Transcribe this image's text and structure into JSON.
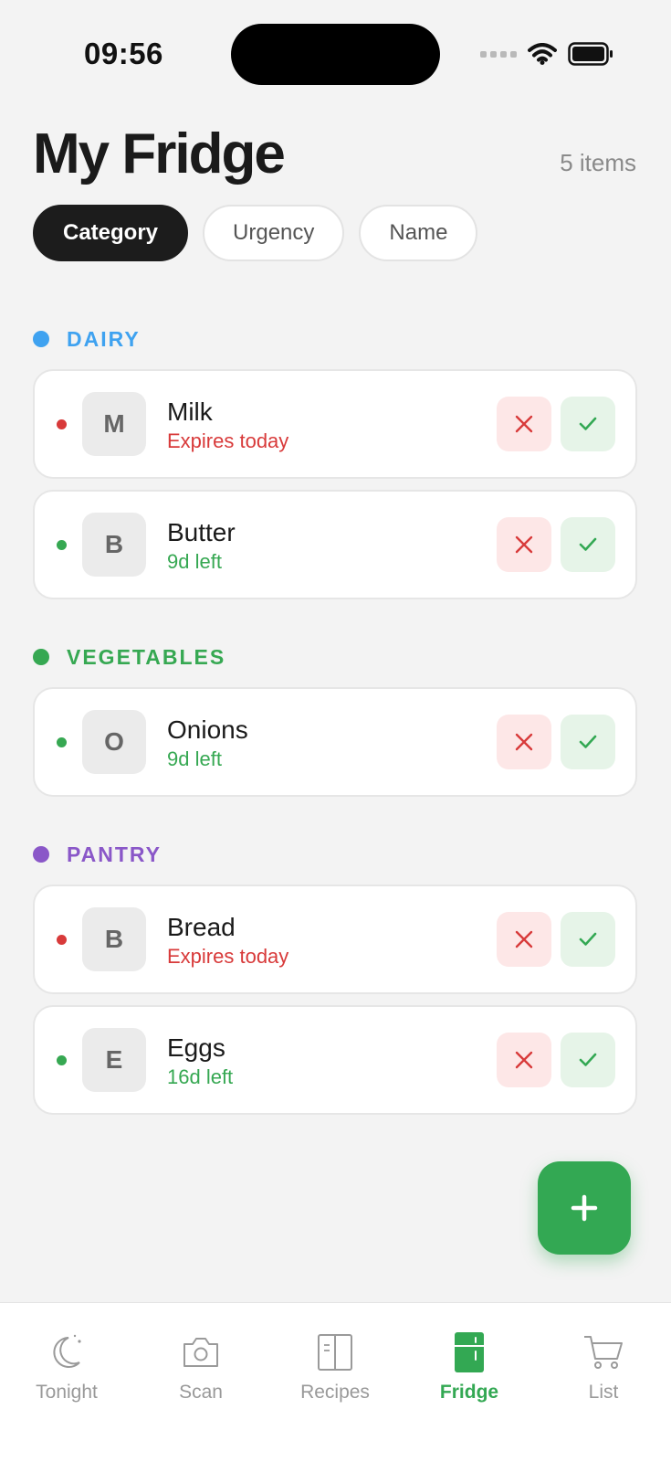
{
  "status_bar": {
    "time": "09:56"
  },
  "header": {
    "title": "My Fridge",
    "count": "5 items"
  },
  "filters": [
    "Category",
    "Urgency",
    "Name"
  ],
  "colors": {
    "dairy": "#3fa2f0",
    "vegetables": "#36a852",
    "pantry": "#8a57c8",
    "urgent": "#d83a3a",
    "ok": "#36a852",
    "accent": "#33a853"
  },
  "sections": [
    {
      "label": "DAIRY",
      "items": [
        {
          "initial": "M",
          "name": "Milk",
          "status": "Expires today"
        },
        {
          "initial": "B",
          "name": "Butter",
          "status": "9d left"
        }
      ]
    },
    {
      "label": "VEGETABLES",
      "items": [
        {
          "initial": "O",
          "name": "Onions",
          "status": "9d left"
        }
      ]
    },
    {
      "label": "PANTRY",
      "items": [
        {
          "initial": "B",
          "name": "Bread",
          "status": "Expires today"
        },
        {
          "initial": "E",
          "name": "Eggs",
          "status": "16d left"
        }
      ]
    }
  ],
  "fab": {
    "icon": "plus-icon"
  },
  "tabs": [
    {
      "label": "Tonight",
      "icon": "moon-icon"
    },
    {
      "label": "Scan",
      "icon": "camera-icon"
    },
    {
      "label": "Recipes",
      "icon": "book-icon"
    },
    {
      "label": "Fridge",
      "icon": "fridge-icon"
    },
    {
      "label": "List",
      "icon": "cart-icon"
    }
  ]
}
